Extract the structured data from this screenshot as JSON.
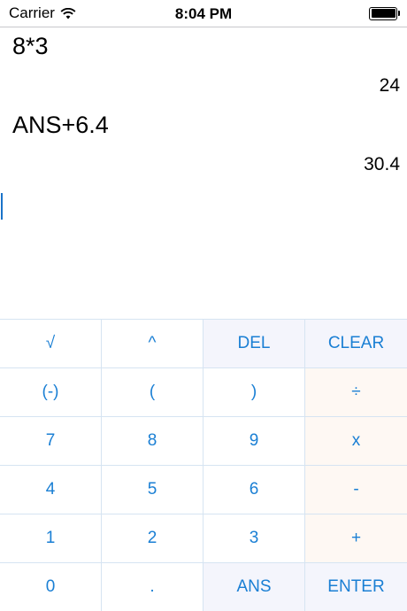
{
  "status_bar": {
    "carrier": "Carrier",
    "time": "8:04 PM",
    "icons": [
      "wifi-icon",
      "battery-icon"
    ]
  },
  "history": [
    {
      "expression": "8*3",
      "result": "24"
    },
    {
      "expression": "ANS+6.4",
      "result": "30.4"
    }
  ],
  "keypad": {
    "rows": [
      [
        {
          "label": "√",
          "kind": "normal"
        },
        {
          "label": "^",
          "kind": "normal"
        },
        {
          "label": "DEL",
          "kind": "func"
        },
        {
          "label": "CLEAR",
          "kind": "func"
        }
      ],
      [
        {
          "label": "(-)",
          "kind": "normal"
        },
        {
          "label": "(",
          "kind": "normal"
        },
        {
          "label": ")",
          "kind": "normal"
        },
        {
          "label": "÷",
          "kind": "op"
        }
      ],
      [
        {
          "label": "7",
          "kind": "normal"
        },
        {
          "label": "8",
          "kind": "normal"
        },
        {
          "label": "9",
          "kind": "normal"
        },
        {
          "label": "x",
          "kind": "op"
        }
      ],
      [
        {
          "label": "4",
          "kind": "normal"
        },
        {
          "label": "5",
          "kind": "normal"
        },
        {
          "label": "6",
          "kind": "normal"
        },
        {
          "label": "-",
          "kind": "op"
        }
      ],
      [
        {
          "label": "1",
          "kind": "normal"
        },
        {
          "label": "2",
          "kind": "normal"
        },
        {
          "label": "3",
          "kind": "normal"
        },
        {
          "label": "+",
          "kind": "op"
        }
      ],
      [
        {
          "label": "0",
          "kind": "normal"
        },
        {
          "label": ".",
          "kind": "normal"
        },
        {
          "label": "ANS",
          "kind": "func"
        },
        {
          "label": "ENTER",
          "kind": "func"
        }
      ]
    ],
    "colors": {
      "key_text": "#1a7fd4",
      "func_bg": "#f4f5fc",
      "op_bg": "#fef8f3",
      "grid_line": "#d6e4f2"
    }
  }
}
